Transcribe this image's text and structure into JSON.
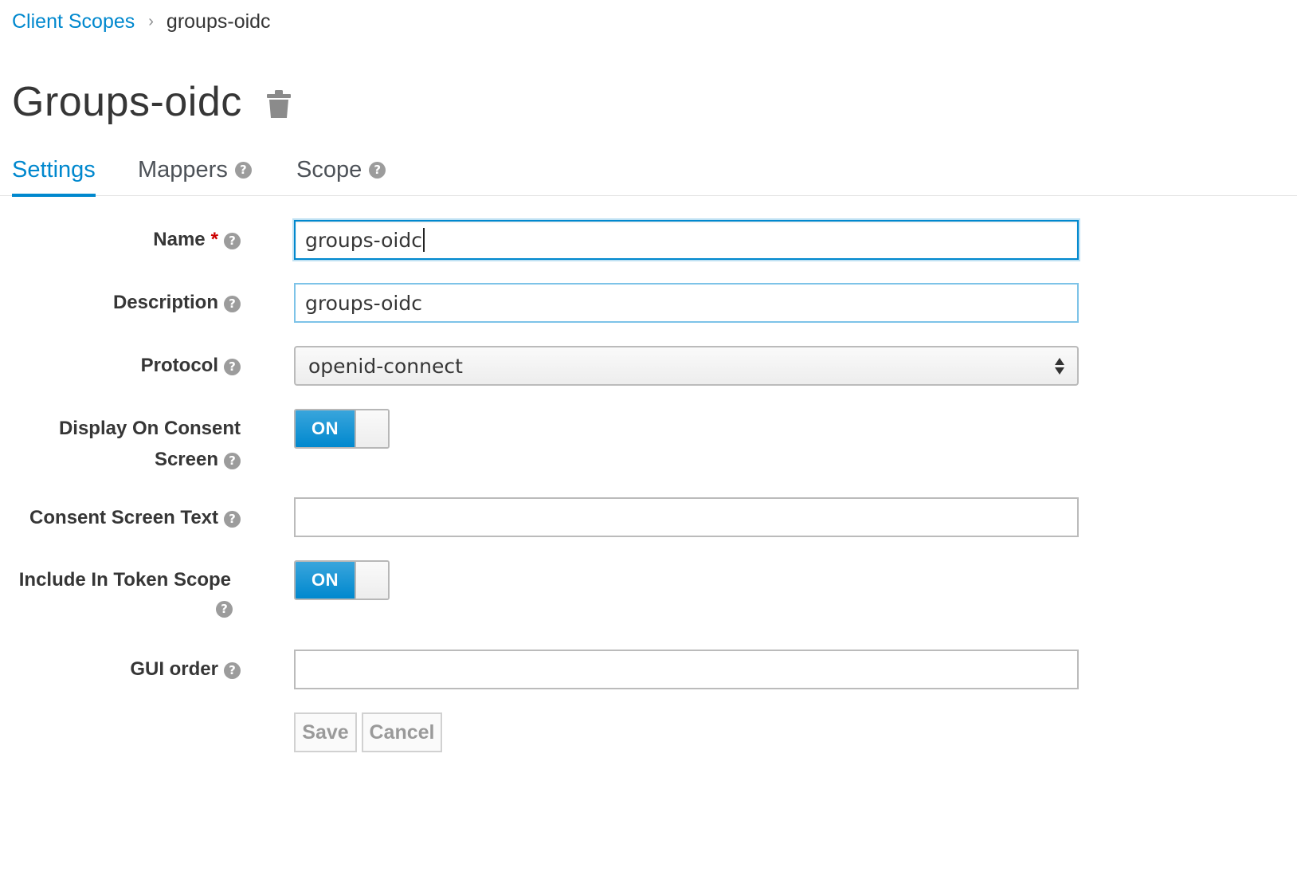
{
  "breadcrumb": {
    "parent": "Client Scopes",
    "separator": "›",
    "current": "groups-oidc"
  },
  "header": {
    "title": "Groups-oidc",
    "delete_icon": "trash-icon"
  },
  "tabs": [
    {
      "label": "Settings",
      "active": true
    },
    {
      "label": "Mappers",
      "active": false
    },
    {
      "label": "Scope",
      "active": false
    }
  ],
  "help_glyph": "?",
  "form": {
    "name": {
      "label": "Name",
      "required_mark": "*",
      "value": "groups-oidc"
    },
    "description": {
      "label": "Description",
      "value": "groups-oidc"
    },
    "protocol": {
      "label": "Protocol",
      "value": "openid-connect"
    },
    "display_on_consent": {
      "label_line1": "Display On Consent",
      "label_line2": "Screen",
      "state": "ON"
    },
    "consent_text": {
      "label": "Consent Screen Text",
      "value": ""
    },
    "include_in_token": {
      "label": "Include In Token Scope",
      "state": "ON"
    },
    "gui_order": {
      "label": "GUI order",
      "value": ""
    }
  },
  "actions": {
    "save_label": "Save",
    "cancel_label": "Cancel"
  },
  "colors": {
    "accent": "#0088ce",
    "required": "#cc0000"
  }
}
